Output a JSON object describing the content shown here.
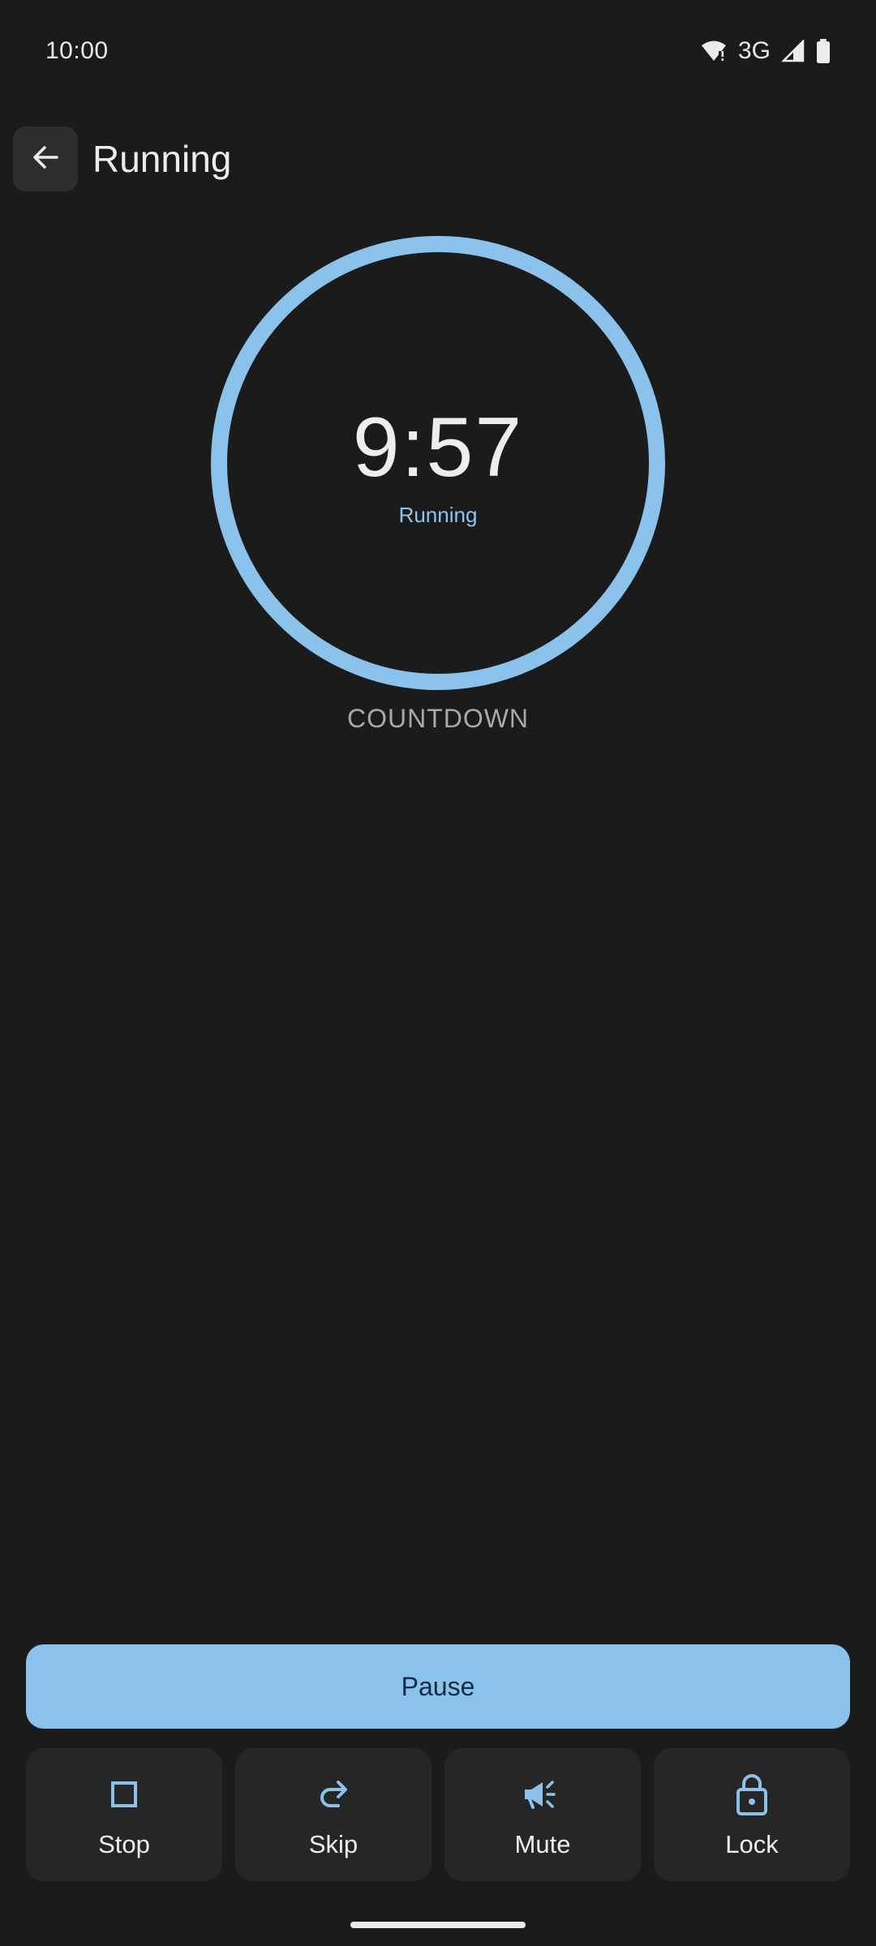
{
  "status_bar": {
    "time": "10:00",
    "network": "3G",
    "icons": [
      "wifi-alert-icon",
      "signal-icon",
      "battery-icon"
    ]
  },
  "header": {
    "back_icon": "arrow-left-icon",
    "title": "Running"
  },
  "timer": {
    "value": "9:57",
    "state": "Running",
    "mode": "COUNTDOWN",
    "ring_color": "#8AC2EC"
  },
  "controls": {
    "primary_label": "Pause",
    "actions": [
      {
        "label": "Stop",
        "icon": "stop-icon"
      },
      {
        "label": "Skip",
        "icon": "redo-icon"
      },
      {
        "label": "Mute",
        "icon": "megaphone-icon"
      },
      {
        "label": "Lock",
        "icon": "lock-icon"
      }
    ]
  },
  "colors": {
    "background": "#1B1B1B",
    "accent": "#8AC2EC",
    "card": "#262626"
  }
}
